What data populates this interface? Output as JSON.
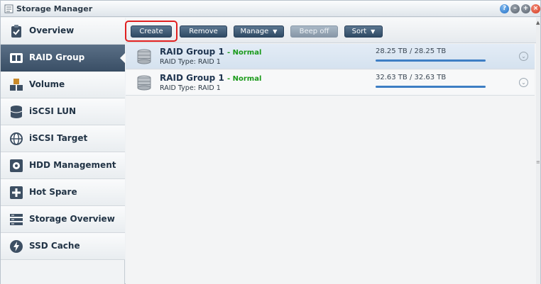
{
  "window": {
    "title": "Storage Manager"
  },
  "sidebar": {
    "items": [
      {
        "label": "Overview",
        "icon": "clipboard-check-icon"
      },
      {
        "label": "RAID Group",
        "icon": "raid-icon"
      },
      {
        "label": "Volume",
        "icon": "volume-icon"
      },
      {
        "label": "iSCSI LUN",
        "icon": "database-icon"
      },
      {
        "label": "iSCSI Target",
        "icon": "globe-icon"
      },
      {
        "label": "HDD Management",
        "icon": "hdd-icon"
      },
      {
        "label": "Hot Spare",
        "icon": "plus-square-icon"
      },
      {
        "label": "Storage Overview",
        "icon": "server-icon"
      },
      {
        "label": "SSD Cache",
        "icon": "bolt-icon"
      }
    ],
    "active": "RAID Group"
  },
  "toolbar": {
    "create": "Create",
    "remove": "Remove",
    "manage": "Manage",
    "beep_off": "Beep off",
    "sort": "Sort"
  },
  "raid_groups": [
    {
      "name": "RAID Group 1",
      "status": "- Normal",
      "type": "RAID Type: RAID 1",
      "size": "28.25 TB / 28.25 TB",
      "usage_fraction": 1.0
    },
    {
      "name": "RAID Group 1",
      "status": "- Normal",
      "type": "RAID Type: RAID 1",
      "size": "32.63 TB / 32.63 TB",
      "usage_fraction": 1.0
    }
  ],
  "colors": {
    "accent": "#3a4f66",
    "status_ok": "#1a9a1a",
    "highlight": "#e02020"
  }
}
